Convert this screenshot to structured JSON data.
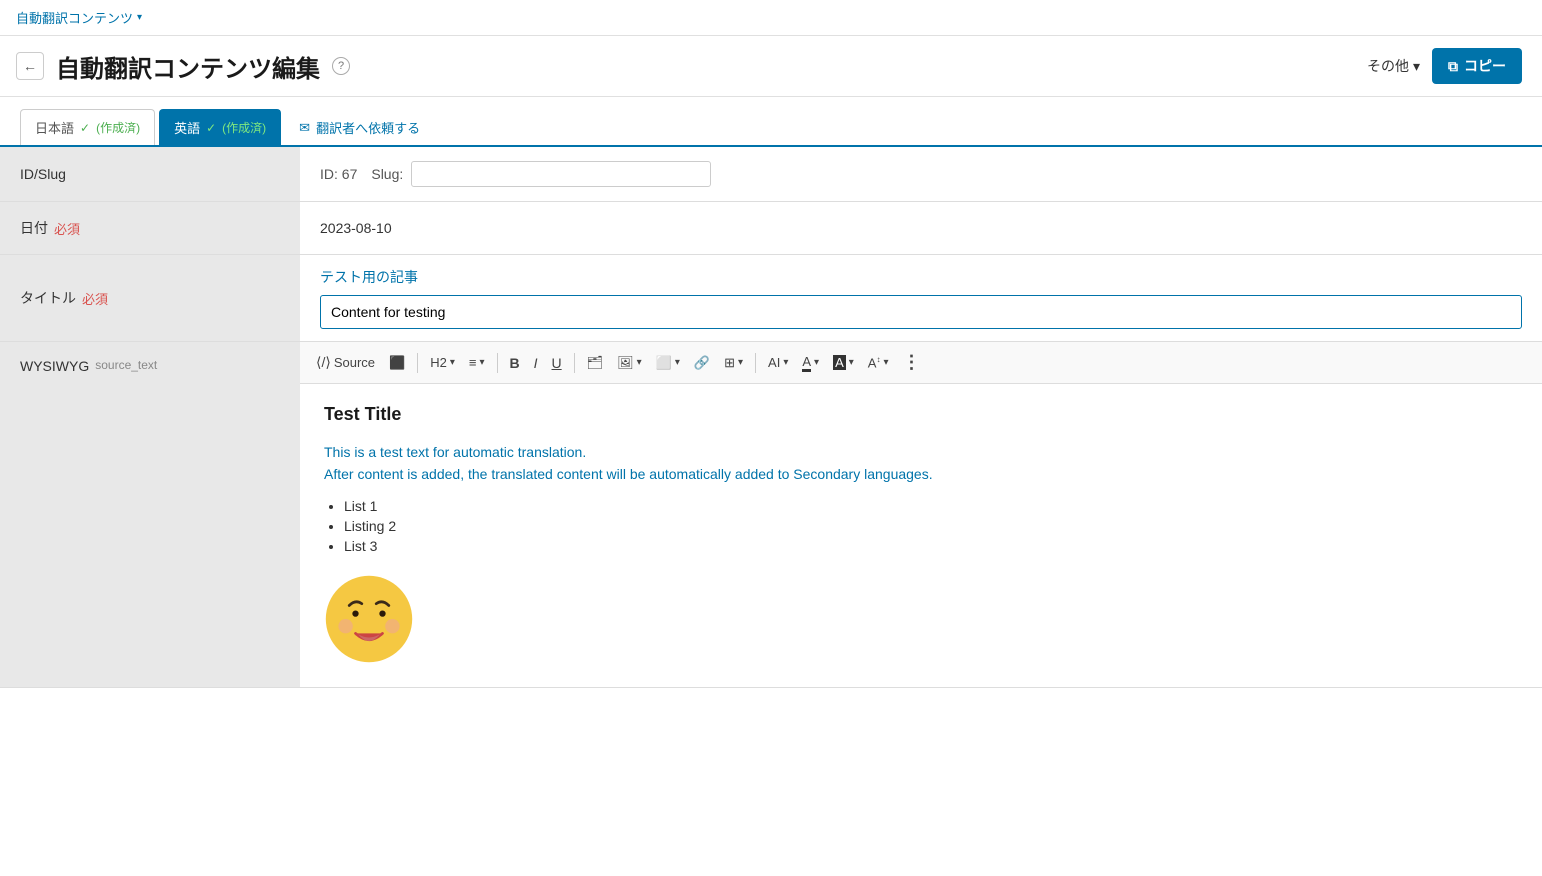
{
  "topNav": {
    "title": "自動翻訳コンテンツ",
    "chevron": "▾"
  },
  "header": {
    "backArrow": "←",
    "title": "自動翻訳コンテンツ編集",
    "helpIcon": "?",
    "otherLabel": "その他",
    "otherChevron": "▾",
    "copyLabel": "コピー",
    "copyIcon": "⧉"
  },
  "tabs": [
    {
      "id": "japanese",
      "label": "日本語",
      "checkIcon": "✓",
      "status": "(作成済)",
      "active": false
    },
    {
      "id": "english",
      "label": "英語",
      "checkIcon": "✓",
      "status": "(作成済)",
      "active": true
    }
  ],
  "requestTab": {
    "icon": "✉",
    "label": "翻訳者へ依頼する"
  },
  "form": {
    "idSlug": {
      "label": "ID/Slug",
      "idPrefix": "ID: 67　Slug:",
      "slugValue": "",
      "slugPlaceholder": ""
    },
    "date": {
      "label": "日付",
      "required": "必須",
      "value": "2023-08-10"
    },
    "title": {
      "label": "タイトル",
      "required": "必須",
      "sourceText": "テスト用の記事",
      "inputValue": "Content for testing"
    },
    "wysiwyg": {
      "label": "WYSIWYG",
      "sublabel": "source_text"
    }
  },
  "toolbar": {
    "sourceLabel": "Source",
    "screenIcon": "⬜",
    "h2Label": "H2",
    "chevron": "▾",
    "alignIcon": "≡",
    "boldLabel": "B",
    "italicLabel": "I",
    "underlineLabel": "U",
    "folderIcon": "🗂",
    "imageIcon": "🖼",
    "mediaIcon": "⬜",
    "linkIcon": "🔗",
    "tableIcon": "⊞",
    "aiIcon": "AI",
    "fontColorIcon": "A",
    "bgColorIcon": "A",
    "sizeIcon": "A",
    "moreIcon": "⋮"
  },
  "editorContent": {
    "heading": "Test Title",
    "line1": "This is a test text for automatic translation.",
    "line2": "After content is added, the translated content will be automatically added to Secondary languages.",
    "listItems": [
      "List 1",
      "Listing 2",
      "List 3"
    ]
  }
}
